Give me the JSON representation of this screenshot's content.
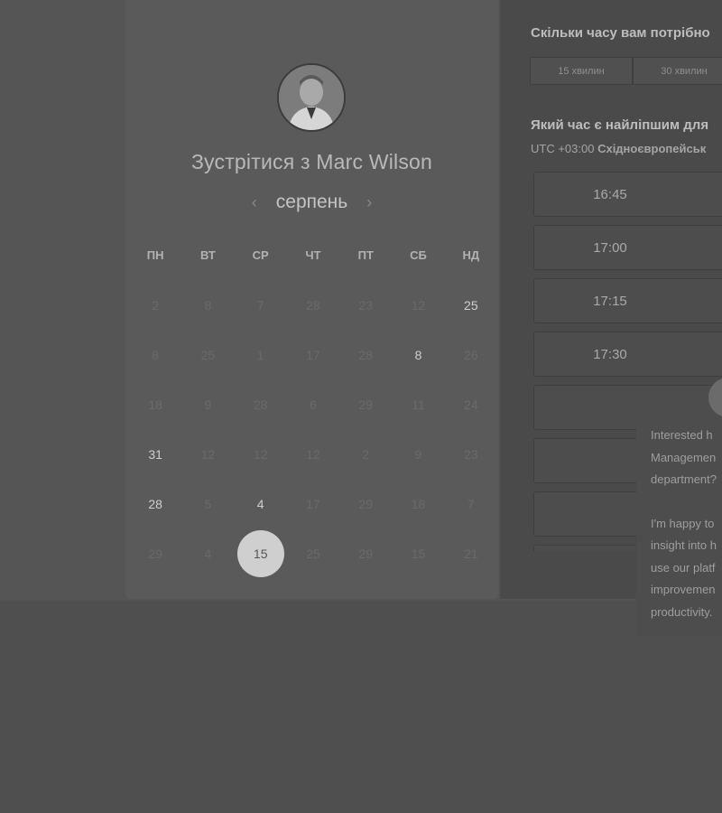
{
  "header": {
    "title": "Зустрітися з Marc Wilson"
  },
  "calendar": {
    "month": "серпень",
    "prev_icon": "chevron-left-icon",
    "next_icon": "chevron-right-icon",
    "weekdays": [
      "ПН",
      "ВТ",
      "СР",
      "ЧТ",
      "ПТ",
      "СБ",
      "НД"
    ],
    "weeks": [
      [
        "2",
        "8",
        "7",
        "28",
        "23",
        "12",
        "25"
      ],
      [
        "8",
        "25",
        "1",
        "17",
        "28",
        "8",
        "26"
      ],
      [
        "18",
        "9",
        "28",
        "6",
        "29",
        "11",
        "24"
      ],
      [
        "31",
        "12",
        "12",
        "12",
        "2",
        "9",
        "23"
      ],
      [
        "28",
        "5",
        "4",
        "17",
        "29",
        "18",
        "7"
      ],
      [
        "29",
        "4",
        "15",
        "25",
        "29",
        "15",
        "21"
      ]
    ],
    "active_days": [
      "0-6",
      "1-5",
      "3-0",
      "4-0",
      "4-2"
    ],
    "selected_day": "15"
  },
  "booking": {
    "duration_question": "Скільки часу вам потрібно",
    "durations": [
      "15 хвилин",
      "30 хвилин"
    ],
    "time_question": "Який час є найліпшим для",
    "timezone_offset": "UTC +03:00",
    "timezone_name": "Східноєвропейськ",
    "slots": [
      "16:45",
      "17:00",
      "17:15",
      "17:30",
      "",
      "",
      "",
      ""
    ]
  },
  "chat": {
    "message_lines_1": [
      "Interested h",
      "Managemen",
      "department?"
    ],
    "message_lines_2": [
      "I'm happy to",
      "insight into h",
      "use our platf",
      "improvemen",
      "productivity."
    ]
  }
}
